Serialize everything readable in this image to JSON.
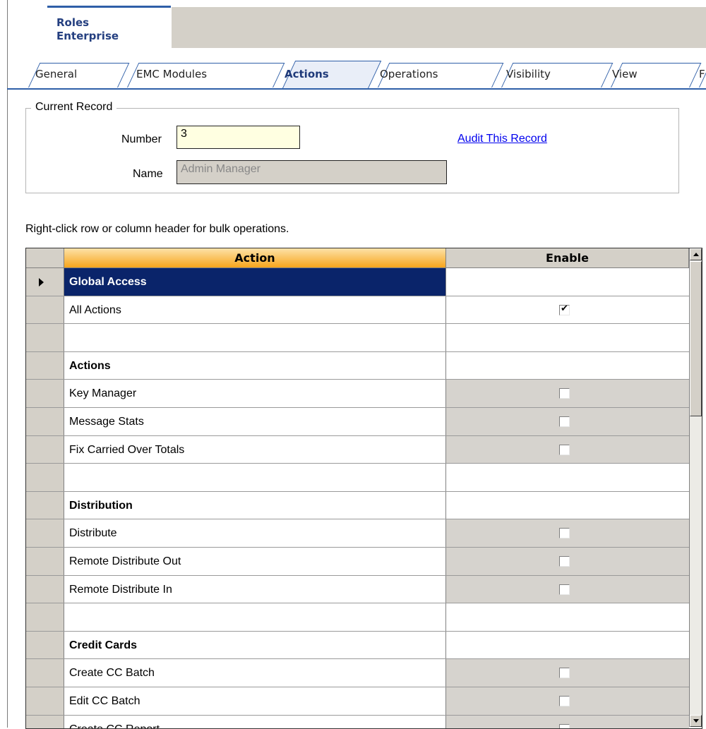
{
  "header": {
    "title_line1": "Roles",
    "title_line2": "Enterprise"
  },
  "tabs": [
    {
      "label": "General",
      "active": false
    },
    {
      "label": "EMC Modules",
      "active": false
    },
    {
      "label": "Actions",
      "active": true
    },
    {
      "label": "Operations",
      "active": false
    },
    {
      "label": "Visibility",
      "active": false
    },
    {
      "label": "View",
      "active": false
    },
    {
      "label": "F",
      "active": false
    }
  ],
  "record": {
    "legend": "Current Record",
    "number_label": "Number",
    "number_value": "3",
    "name_label": "Name",
    "name_value": "Admin Manager",
    "audit_link": "Audit This Record"
  },
  "hint": "Right-click row or column header for bulk operations.",
  "grid": {
    "columns": {
      "action": "Action",
      "enable": "Enable"
    },
    "rows": [
      {
        "label": "Global Access",
        "type": "header",
        "selected": true
      },
      {
        "label": "All Actions",
        "type": "item",
        "checked": true,
        "gray": false
      },
      {
        "label": "",
        "type": "blank"
      },
      {
        "label": "Actions",
        "type": "header"
      },
      {
        "label": "Key Manager",
        "type": "item",
        "checked": false,
        "gray": true
      },
      {
        "label": "Message Stats",
        "type": "item",
        "checked": false,
        "gray": true
      },
      {
        "label": "Fix Carried Over Totals",
        "type": "item",
        "checked": false,
        "gray": true
      },
      {
        "label": "",
        "type": "blank"
      },
      {
        "label": "Distribution",
        "type": "header"
      },
      {
        "label": "Distribute",
        "type": "item",
        "checked": false,
        "gray": true
      },
      {
        "label": "Remote Distribute Out",
        "type": "item",
        "checked": false,
        "gray": true
      },
      {
        "label": "Remote Distribute In",
        "type": "item",
        "checked": false,
        "gray": true
      },
      {
        "label": "",
        "type": "blank"
      },
      {
        "label": "Credit Cards",
        "type": "header"
      },
      {
        "label": "Create CC Batch",
        "type": "item",
        "checked": false,
        "gray": true
      },
      {
        "label": "Edit CC Batch",
        "type": "item",
        "checked": false,
        "gray": true
      },
      {
        "label": "Create CC Report",
        "type": "item",
        "checked": false,
        "gray": true
      }
    ]
  }
}
